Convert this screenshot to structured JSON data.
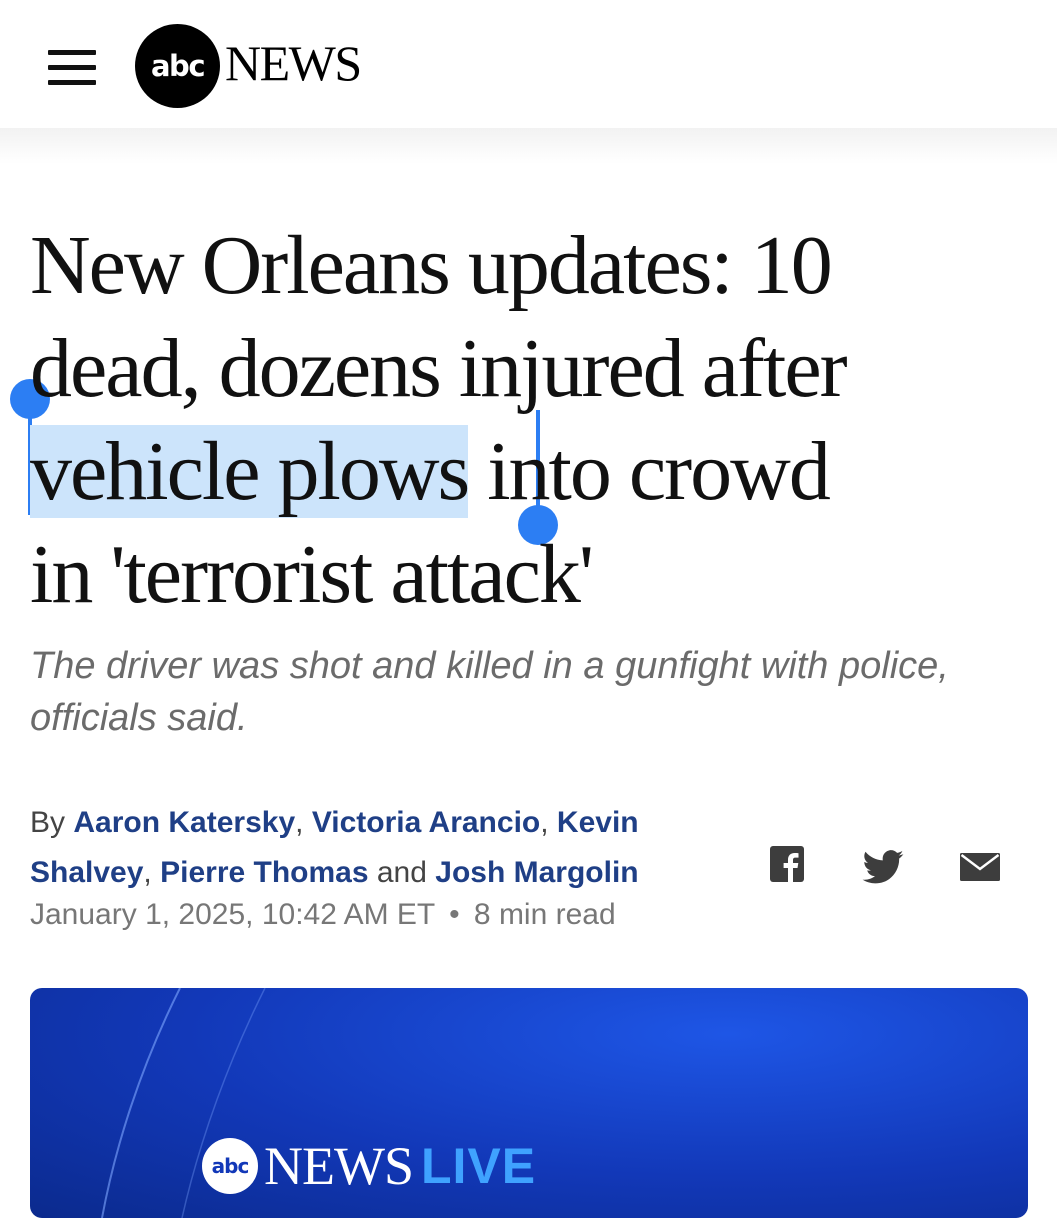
{
  "header": {
    "menu_icon": "hamburger-menu-icon",
    "logo_mark": "abc",
    "logo_word": "NEWS"
  },
  "article": {
    "headline": {
      "line1": "New Orleans updates: 10",
      "line2": "dead, dozens injured after",
      "line3_selected": "vehicle plows",
      "line3_rest": " into crowd",
      "line4": "in 'terrorist attack'"
    },
    "selection_color": "#cce4fb",
    "selection_handle_color": "#2c7ef3",
    "subhead": "The driver was shot and killed in a gunfight with police, officials said.",
    "byline": {
      "prefix": "By",
      "authors": [
        "Aaron Katersky",
        "Victoria Arancio",
        "Kevin Shalvey",
        "Pierre Thomas",
        "Josh Margolin"
      ],
      "sep": ",",
      "and": "and"
    },
    "date": "January 1, 2025, 10:42 AM ET",
    "bullet": "•",
    "read_time": "8 min read",
    "share_icons": [
      "facebook-icon",
      "twitter-icon",
      "email-icon"
    ]
  },
  "video": {
    "logo_mark": "abc",
    "logo_news": "NEWS",
    "logo_live": "LIVE"
  },
  "colors": {
    "author_link": "#1f3f86",
    "video_blue": "#1238b8",
    "live_blue": "#3fa2ff"
  }
}
